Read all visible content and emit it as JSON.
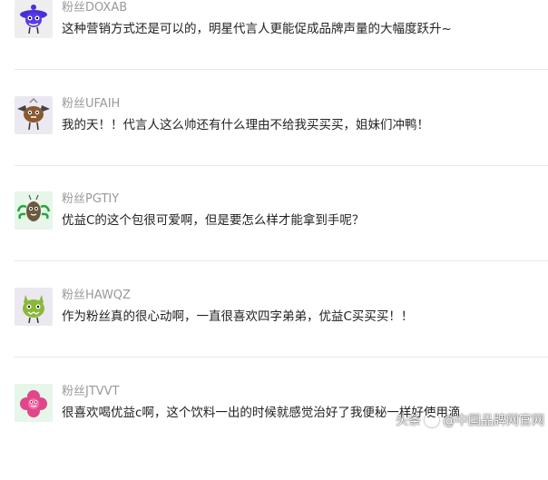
{
  "comments": [
    {
      "user": "粉丝DOXAB",
      "text": "这种营销方式还是可以的，明星代言人更能促成品牌声量的大幅度跃升~",
      "avatar": "blue-monster-avatar-icon"
    },
    {
      "user": "粉丝UFAIH",
      "text": "我的天！！代言人这么帅还有什么理由不给我买买买，姐妹们冲鸭！",
      "avatar": "brown-bat-monster-avatar-icon"
    },
    {
      "user": "粉丝PGTIY",
      "text": "优益C的这个包很可爱啊，但是要怎么样才能拿到手呢？",
      "avatar": "green-bug-monster-avatar-icon"
    },
    {
      "user": "粉丝HAWQZ",
      "text": "作为粉丝真的很心动啊，一直很喜欢四字弟弟，优益C买买买！！",
      "avatar": "green-cat-monster-avatar-icon"
    },
    {
      "user": "粉丝JTVVT",
      "text": "很喜欢喝优益c啊，这个饮料一出的时候就感觉治好了我便秘一样好使用滴",
      "avatar": "pink-flower-monster-avatar-icon"
    }
  ],
  "watermark": {
    "prefix": "头条",
    "handle": "@中国品牌网官网"
  },
  "colors": {
    "username": "#999999",
    "text": "#222222",
    "divider": "#e8e8e8"
  }
}
